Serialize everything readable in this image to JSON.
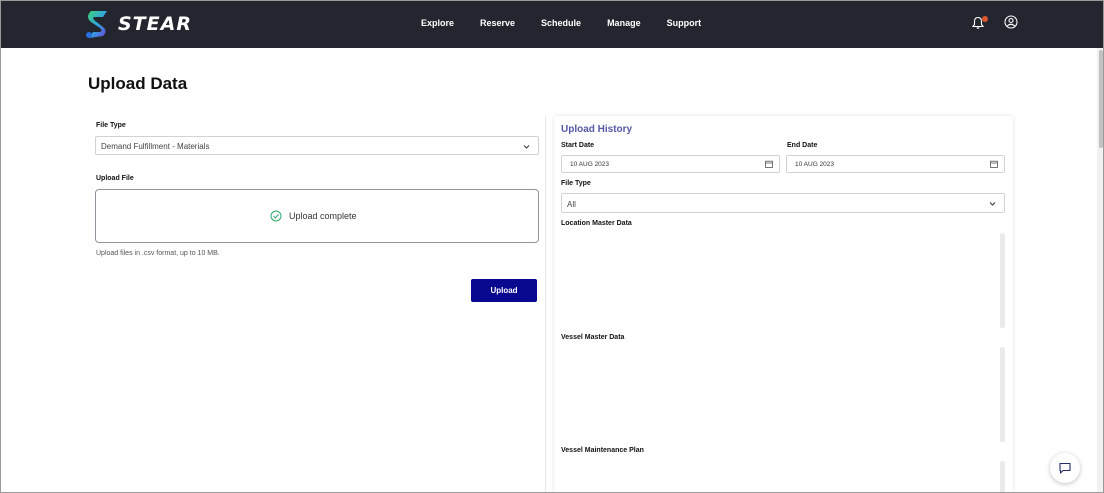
{
  "header": {
    "logo_text": "STEAR",
    "nav": [
      "Explore",
      "Reserve",
      "Schedule",
      "Manage",
      "Support"
    ],
    "icons": {
      "notification": "bell-icon",
      "account": "user-circle-icon"
    },
    "brand_colors": {
      "topbar": "#24262f",
      "accent": "#07088f",
      "title": "#5458a4",
      "notification_dot": "#e0562c"
    }
  },
  "page": {
    "title": "Upload Data"
  },
  "upload_form": {
    "file_type_label": "File Type",
    "file_type_value": "Demand Fulfillment - Materials",
    "upload_file_label": "Upload File",
    "status_text": "Upload complete",
    "hint": "Upload files in .csv format, up to 10 MB.",
    "upload_button": "Upload"
  },
  "history": {
    "title": "Upload History",
    "start_date_label": "Start Date",
    "start_date_value": "10 AUG 2023",
    "end_date_label": "End Date",
    "end_date_value": "10 AUG 2023",
    "file_type_label": "File Type",
    "file_type_value": "All",
    "sections": [
      "Location Master Data",
      "Vessel Master Data",
      "Vessel Maintenance Plan"
    ]
  }
}
